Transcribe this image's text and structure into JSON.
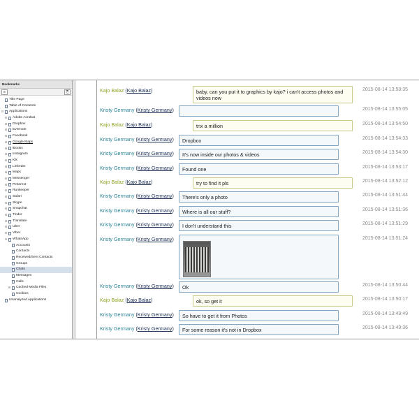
{
  "bookmarks": {
    "header": "Bookmarks",
    "toolbar": {
      "btn_a": "≡",
      "btn_b": "⎘"
    },
    "items": [
      {
        "label": "Title Page",
        "indent": 0,
        "exp": ""
      },
      {
        "label": "Table of Contents",
        "indent": 0,
        "exp": ""
      },
      {
        "label": "Applications",
        "indent": 0,
        "exp": "⊟"
      },
      {
        "label": "Adobe Acrobat",
        "indent": 1,
        "exp": "⊞"
      },
      {
        "label": "Dropbox",
        "indent": 1,
        "exp": "⊞"
      },
      {
        "label": "Evernote",
        "indent": 1,
        "exp": "⊞"
      },
      {
        "label": "Facebook",
        "indent": 1,
        "exp": "⊞"
      },
      {
        "label": "Google Maps",
        "indent": 1,
        "exp": "⊞",
        "underline": true
      },
      {
        "label": "iBooks",
        "indent": 1,
        "exp": "⊞"
      },
      {
        "label": "Instagram",
        "indent": 1,
        "exp": "⊞"
      },
      {
        "label": "Kik",
        "indent": 1,
        "exp": "⊞"
      },
      {
        "label": "LinkedIn",
        "indent": 1,
        "exp": "⊞"
      },
      {
        "label": "Maps",
        "indent": 1,
        "exp": "⊞"
      },
      {
        "label": "Messenger",
        "indent": 1,
        "exp": "⊞"
      },
      {
        "label": "Pinterest",
        "indent": 1,
        "exp": "⊞"
      },
      {
        "label": "Runkeeper",
        "indent": 1,
        "exp": "⊞"
      },
      {
        "label": "Safari",
        "indent": 1,
        "exp": "⊞"
      },
      {
        "label": "Skype",
        "indent": 1,
        "exp": "⊞"
      },
      {
        "label": "Snapchat",
        "indent": 1,
        "exp": "⊞"
      },
      {
        "label": "Tinder",
        "indent": 1,
        "exp": "⊞"
      },
      {
        "label": "Translate",
        "indent": 1,
        "exp": "⊞"
      },
      {
        "label": "Uber",
        "indent": 1,
        "exp": "⊞"
      },
      {
        "label": "Viber",
        "indent": 1,
        "exp": "⊞"
      },
      {
        "label": "WhatsApp",
        "indent": 1,
        "exp": "⊟"
      },
      {
        "label": "Accounts",
        "indent": 2,
        "exp": ""
      },
      {
        "label": "Contacts",
        "indent": 2,
        "exp": ""
      },
      {
        "label": "Received/Sent Contacts",
        "indent": 2,
        "exp": ""
      },
      {
        "label": "Groups",
        "indent": 2,
        "exp": ""
      },
      {
        "label": "Chats",
        "indent": 2,
        "exp": "",
        "selected": true
      },
      {
        "label": "Messages",
        "indent": 2,
        "exp": ""
      },
      {
        "label": "Calls",
        "indent": 2,
        "exp": ""
      },
      {
        "label": "Cached Media Files",
        "indent": 2,
        "exp": "⊞"
      },
      {
        "label": "Cookies",
        "indent": 2,
        "exp": ""
      },
      {
        "label": "Unanalyzed Applications",
        "indent": 0,
        "exp": ""
      }
    ]
  },
  "chat": {
    "messages": [
      {
        "sender": "kajo",
        "name": "Kajo Balaz",
        "alias": "Kajo Balaz",
        "text": "baby, can you put it to graphics by kajo? i can't access photos and videos now",
        "time": "2015-08-14 13:58:35",
        "lines": 2
      },
      {
        "sender": "kristy",
        "name": "Kristy Germany",
        "alias": "Kristy Germany",
        "text": "",
        "time": "2015-08-14 13:55:05",
        "lines": 1
      },
      {
        "sender": "kajo",
        "name": "Kajo Balaz",
        "alias": "Kajo Balaz",
        "text": "tnx a million",
        "time": "2015-08-14 13:54:50",
        "lines": 1
      },
      {
        "sender": "kristy",
        "name": "Kristy Germany",
        "alias": "Kristy Germany",
        "text": "Dropbox",
        "time": "2015-08-14 13:54:33",
        "lines": 1
      },
      {
        "sender": "kristy",
        "name": "Kristy Germany",
        "alias": "Kristy Germany",
        "text": "It's now inside our photos & videos",
        "time": "2015-08-14 13:54:30",
        "lines": 1
      },
      {
        "sender": "kristy",
        "name": "Kristy Germany",
        "alias": "Kristy Germany",
        "text": "Found one",
        "time": "2015-08-14 13:53:17",
        "lines": 1
      },
      {
        "sender": "kajo",
        "name": "Kajo Balaz",
        "alias": "Kajo Balaz",
        "text": "try to find it pls",
        "time": "2015-08-14 13:52:12",
        "lines": 1
      },
      {
        "sender": "kristy",
        "name": "Kristy Germany",
        "alias": "Kristy Germany",
        "text": "There's only a photo",
        "time": "2015-08-14 13:51:44",
        "lines": 1
      },
      {
        "sender": "kristy",
        "name": "Kristy Germany",
        "alias": "Kristy Germany",
        "text": "Where is all our stuff?",
        "time": "2015-08-14 13:51:36",
        "lines": 1
      },
      {
        "sender": "kristy",
        "name": "Kristy Germany",
        "alias": "Kristy Germany",
        "text": "I don't understand this",
        "time": "2015-08-14 13:51:29",
        "lines": 1
      },
      {
        "sender": "kristy",
        "name": "Kristy Germany",
        "alias": "Kristy Germany",
        "text": "",
        "time": "2015-08-14 13:51:24",
        "photo": true
      },
      {
        "sender": "kristy",
        "name": "Kristy Germany",
        "alias": "Kristy Germany",
        "text": "Ok",
        "time": "2015-08-14 13:50:44",
        "lines": 1
      },
      {
        "sender": "kajo",
        "name": "Kajo Balaz",
        "alias": "Kajo Balaz",
        "text": "ok, so get it",
        "time": "2015-08-14 13:50:17",
        "lines": 1
      },
      {
        "sender": "kristy",
        "name": "Kristy Germany",
        "alias": "Kristy Germany",
        "text": "So have to get it from Photos",
        "time": "2015-08-14 13:49:49",
        "lines": 1
      },
      {
        "sender": "kristy",
        "name": "Kristy Germany",
        "alias": "Kristy Germany",
        "text": "For some reason it's not in Dropbox",
        "time": "2015-08-14 13:49:36",
        "lines": 1
      }
    ]
  }
}
